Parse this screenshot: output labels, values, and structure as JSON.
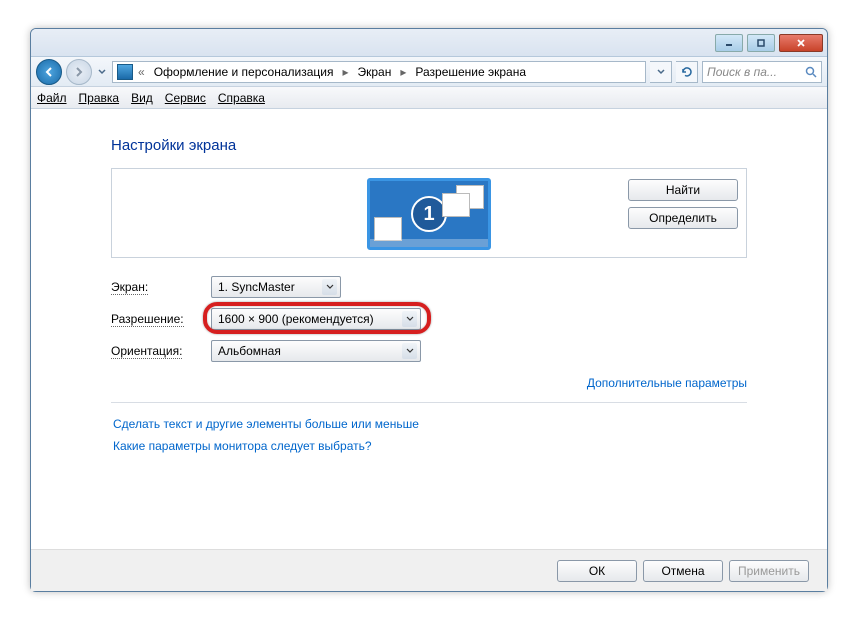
{
  "titlebar": {},
  "breadcrumbs": {
    "prefix": "«",
    "item1": "Оформление и персонализация",
    "item2": "Экран",
    "item3": "Разрешение экрана"
  },
  "search": {
    "placeholder": "Поиск в па..."
  },
  "menubar": {
    "file": "Файл",
    "edit": "Правка",
    "view": "Вид",
    "tools": "Сервис",
    "help": "Справка"
  },
  "page": {
    "title": "Настройки экрана",
    "monitor_number": "1",
    "find_btn": "Найти",
    "detect_btn": "Определить"
  },
  "form": {
    "display_label": "Экран:",
    "display_value": "1. SyncMaster",
    "resolution_label": "Разрешение:",
    "resolution_value": "1600 × 900 (рекомендуется)",
    "orientation_label": "Ориентация:",
    "orientation_value": "Альбомная"
  },
  "links": {
    "advanced": "Дополнительные параметры",
    "text_size": "Сделать текст и другие элементы больше или меньше",
    "which_settings": "Какие параметры монитора следует выбрать?"
  },
  "footer": {
    "ok": "ОК",
    "cancel": "Отмена",
    "apply": "Применить"
  }
}
